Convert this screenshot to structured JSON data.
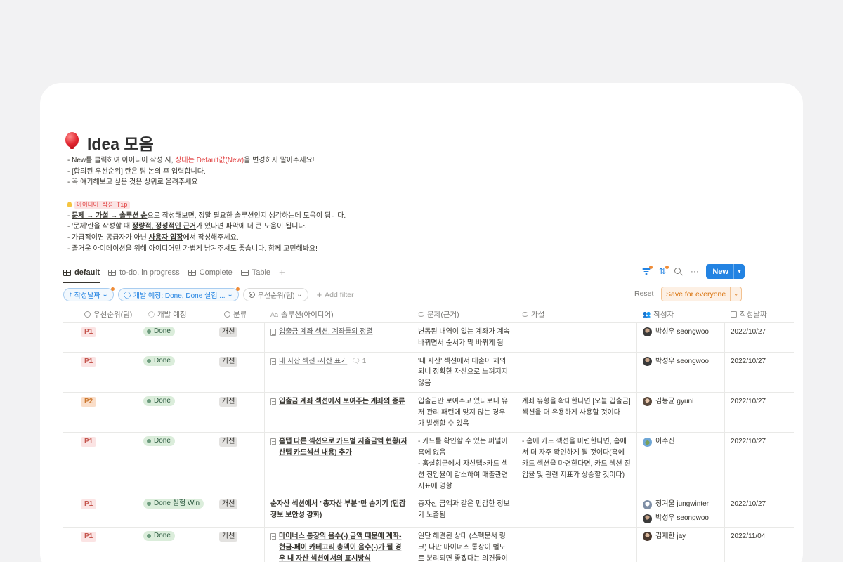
{
  "page": {
    "title": "Idea 모음",
    "icon": "balloon-icon",
    "intro": [
      [
        "- New를 클릭하여 아이디어 작성 시, ",
        "상태는 Default값(New)",
        "을 변경하지 말아주세요!"
      ],
      "- [합의된 우선순위] 란은 팀 논의 후 입력합니다.",
      "- 꼭 얘기해보고 싶은 것은 상위로 올려주세요"
    ],
    "tip_label": "아이디어 작성 Tip",
    "tips": [
      [
        "- ",
        "문제 → 가설 → 솔루션 순",
        "으로 작성해보면, 정말 필요한 솔루션인지 생각하는데 도움이 됩니다."
      ],
      [
        "- '문제'란을 작성할 때 ",
        "정량적, 정성적인 근거",
        "가 있다면 파악에 더 큰 도움이 됩니다."
      ],
      [
        "- 가급적이면 공급자가 아닌 ",
        "사용자 입장",
        "에서 작성해주세요."
      ],
      [
        "- 즐거운 아이데이션을 위해 아이디어만 가볍게 남겨주셔도 좋습니다. 함께 고민해봐요!"
      ]
    ]
  },
  "tabs": [
    "default",
    "to-do, in progress",
    "Complete",
    "Table"
  ],
  "toolbar": {
    "new_label": "New",
    "icons": [
      "filter-icon",
      "sort-icon",
      "search-icon",
      "more-icon"
    ]
  },
  "filters": {
    "sort": "작성날짜",
    "status": "개발 예정: Done, Done 실험 ...",
    "priority": "우선순위(팀)",
    "add": "Add filter",
    "reset": "Reset",
    "save": "Save for everyone"
  },
  "columns": [
    "우선순위(팀)",
    "개발 예정",
    "분류",
    "솔루션(아이디어)",
    "문제(근거)",
    "가설",
    "작성자",
    "작성날짜"
  ],
  "rows": [
    {
      "priority": "P1",
      "status": "Done",
      "category": "개선",
      "solution": "입출금 계좌 섹션, 계좌들의 정렬",
      "solution_light": true,
      "comments": "",
      "problem": [
        "변동된 내역이 있는 계좌가 계속 바뀌면서 순서가 막 바뀌게 됨"
      ],
      "hypothesis": [],
      "authors": [
        "박성우 seongwoo"
      ],
      "date": "2022/10/27"
    },
    {
      "priority": "P1",
      "status": "Done",
      "category": "개선",
      "solution": "내 자산 섹션 -자산 표기",
      "solution_light": true,
      "comments": "1",
      "problem": [
        "'내 자산' 섹션에서 대출이 제외되니 정확한 자산으로 느껴지지 않음"
      ],
      "hypothesis": [],
      "authors": [
        "박성우 seongwoo"
      ],
      "date": "2022/10/27"
    },
    {
      "priority": "P2",
      "status": "Done",
      "category": "개선",
      "solution": "입출금 계좌 섹션에서 보여주는 계좌의 종류",
      "solution_light": false,
      "comments": "",
      "problem": [
        "입출금만 보여주고 있다보니 유저 관리 패턴에 맞지 않는 경우가 발생할 수 있음"
      ],
      "hypothesis": [
        "계좌 유형을 확대한다면 [오늘 입출금] 섹션을 더 유용하게 사용할 것이다"
      ],
      "authors": [
        "김봉균 gyuni"
      ],
      "date": "2022/10/27"
    },
    {
      "priority": "P1",
      "status": "Done",
      "category": "개선",
      "solution": "홈탭 다른 섹션으로 카드별 지출금액 현황(자산탭 카드섹션 내용) 추가",
      "solution_light": false,
      "comments": "",
      "problem": [
        "- 카드를 확인할 수 있는 퍼널이 홈에 없음",
        "- 홈실험군에서 자산탭>카드 섹션 진입율이 감소하여 매출관련 지표에 영향"
      ],
      "hypothesis": [
        "- 홈에 카드 섹션을 마련한다면, 홈에서 더 자주 확인하게 될 것이다(홈에 카드 섹션을 마련한다면, 카드 섹션 진입율 및 관련 지표가 상승할 것이다)"
      ],
      "authors": [
        "이수진"
      ],
      "date": "2022/10/27"
    },
    {
      "priority": "P1",
      "status": "Done 실험 Win",
      "category": "개선",
      "solution": "순자산 섹션에서 \"총자산 부분\"만 숨기기 (민감정보 보안성 강화)",
      "solution_light": false,
      "comments": "",
      "no_doc_icon": true,
      "problem": [
        "총자산 금액과 같은 민감한 정보가 노출됨"
      ],
      "hypothesis": [],
      "authors": [
        "정겨울 jungwinter",
        "박성우 seongwoo"
      ],
      "date": "2022/10/27"
    },
    {
      "priority": "P1",
      "status": "Done",
      "category": "개선",
      "solution": "마이너스 통장의 음수(-) 금액 때문에 계좌-현금-페이 카테고리 총액이 음수(-)가 될 경우 내 자산 섹션에서의 표시방식",
      "solution_light": false,
      "comments": "",
      "problem": [
        "일단 해결된 상태 (스펙문서 링크) 다만 마이너스 통장이 별도로 분리되면 좋겠다는 의견들이 있었음"
      ],
      "hypothesis": [],
      "authors": [
        "김재한 jay"
      ],
      "date": "2022/11/04"
    }
  ],
  "colors": {
    "accent": "#2383e2",
    "p1_bg": "#fbe4e4",
    "p1_fg": "#c4554d",
    "p2_bg": "#fadec9",
    "p2_fg": "#cc782f",
    "done_bg": "#dbeddb",
    "save_bg": "#fdf0e4",
    "save_fg": "#d9730d"
  }
}
